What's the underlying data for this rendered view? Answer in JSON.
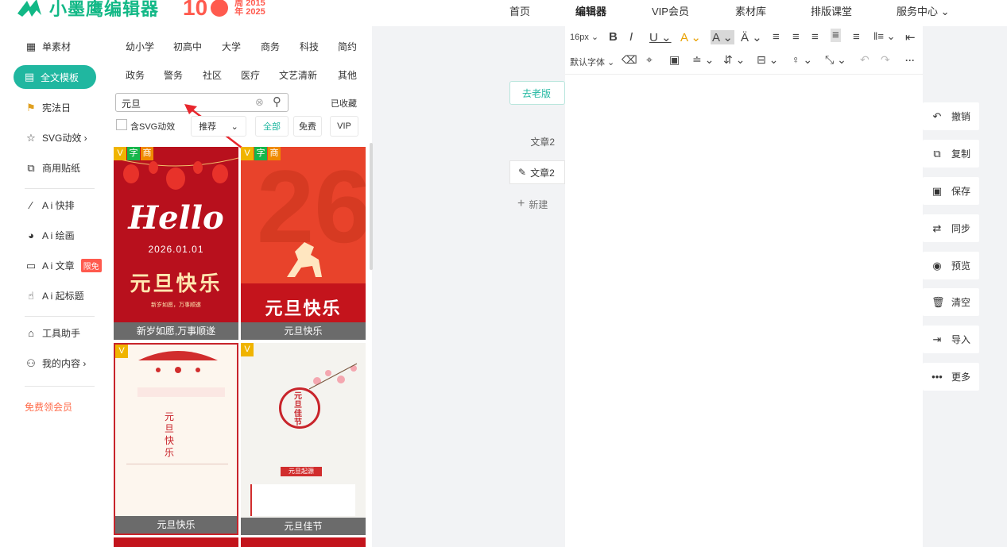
{
  "brand": {
    "name": "小墨鹰编辑器",
    "anniv_number": "10",
    "anniv_line1": "周 2015",
    "anniv_line2": "年 2025",
    "color": "#12b886"
  },
  "nav": [
    "首页",
    "编辑器",
    "VIP会员",
    "素材库",
    "排版课堂",
    "服务中心 ⌄"
  ],
  "sidebar": {
    "items": [
      {
        "icon": "grid-icon",
        "glyph": "▦",
        "label": "单素材"
      },
      {
        "icon": "template-icon",
        "glyph": "▤",
        "label": "全文模板"
      },
      {
        "icon": "flag-icon",
        "glyph": "⚑",
        "label": "宪法日"
      },
      {
        "icon": "star-icon",
        "glyph": "☆",
        "label": "SVG动效 ›"
      },
      {
        "icon": "puzzle-icon",
        "glyph": "⧉",
        "label": "商用贴纸"
      },
      {
        "icon": "ai-typeset-icon",
        "glyph": "⁄",
        "label": "A i 快排"
      },
      {
        "icon": "palette-icon",
        "glyph": "◕",
        "label": "A i 绘画"
      },
      {
        "icon": "document-icon",
        "glyph": "▭",
        "label": "A i 文章"
      },
      {
        "icon": "hand-icon",
        "glyph": "☝",
        "label": "A i 起标题"
      },
      {
        "icon": "tools-icon",
        "glyph": "⌂",
        "label": "工具助手"
      },
      {
        "icon": "user-icon",
        "glyph": "⚇",
        "label": "我的内容 ›"
      }
    ],
    "free_badge": "限免",
    "vip_link": "免费领会员"
  },
  "categories": [
    "幼小学",
    "初高中",
    "大学",
    "商务",
    "科技",
    "简约",
    "政务",
    "警务",
    "社区",
    "医疗",
    "文艺清新",
    "其他"
  ],
  "search": {
    "value": "元旦",
    "saved_label": "已收藏"
  },
  "filters": {
    "svg_checkbox": "含SVG动效",
    "sort": "推荐",
    "all": "全部",
    "free": "免费",
    "vip": "VIP"
  },
  "templates": [
    {
      "caption": "新岁如愿,万事顺遂",
      "hello": "Hello",
      "date": "2026.01.01",
      "title": "元旦快乐",
      "sub": "新岁如愿，万事顺遂",
      "tag_v": "V",
      "tag_zi": "字",
      "tag_shang": "商"
    },
    {
      "caption": "元旦快乐",
      "big": "26",
      "title": "元旦快乐",
      "tag_v": "V",
      "tag_zi": "字",
      "tag_shang": "商"
    },
    {
      "caption": "元旦快乐",
      "title_v": "元旦快乐",
      "tag_v": "V"
    },
    {
      "caption": "元旦佳节",
      "title_v": "元旦佳节",
      "banner": "元旦起源",
      "tag_v": "V"
    }
  ],
  "article_tabs": {
    "old_version": "去老版",
    "tab1": "文章2",
    "tab2": "文章2",
    "new": "新建"
  },
  "toolbar": {
    "row1": [
      "16px ⌄",
      "B",
      "I",
      "U ⌄",
      "A ⌄",
      "A ⌄",
      "Ä ⌄",
      "≡",
      "≡",
      "≡",
      "≡",
      "≡",
      "‖≡ ⌄",
      "⇤"
    ],
    "row2": [
      "默认字体 ⌄",
      "⌫",
      "⌖",
      "▣",
      "≐ ⌄",
      "⇵ ⌄",
      "⊟ ⌄",
      "♀ ⌄",
      "⤡ ⌄",
      "↶",
      "↷",
      "···"
    ]
  },
  "right_actions": [
    {
      "icon": "undo-icon",
      "glyph": "↶",
      "label": "撤销"
    },
    {
      "icon": "copy-icon",
      "glyph": "⧉",
      "label": "复制"
    },
    {
      "icon": "save-icon",
      "glyph": "▣",
      "label": "保存"
    },
    {
      "icon": "sync-icon",
      "glyph": "⇄",
      "label": "同步"
    },
    {
      "icon": "eye-icon",
      "glyph": "◉",
      "label": "预览"
    },
    {
      "icon": "trash-icon",
      "glyph": "🗑",
      "label": "清空"
    },
    {
      "icon": "import-icon",
      "glyph": "⇥",
      "label": "导入"
    },
    {
      "icon": "more-icon",
      "glyph": "•••",
      "label": "更多"
    }
  ]
}
